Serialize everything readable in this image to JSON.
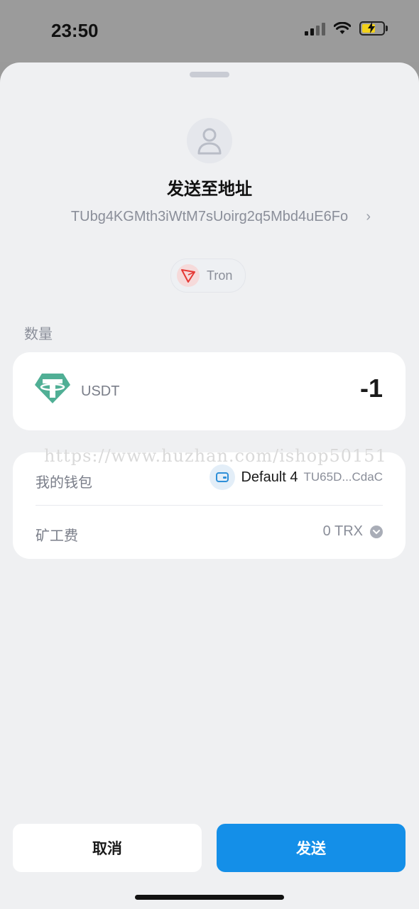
{
  "status_bar": {
    "time": "23:50"
  },
  "recipient": {
    "title": "发送至地址",
    "address": "TUbg4KGMth3iWtM7sUoirg2q5Mbd4uE6Fo",
    "network": "Tron"
  },
  "amount": {
    "section_label": "数量",
    "token": "USDT",
    "value": "-1"
  },
  "details": {
    "wallet_label": "我的钱包",
    "wallet_name": "Default 4",
    "wallet_address": "TU65D...CdaC",
    "fee_label": "矿工费",
    "fee_value": "0 TRX"
  },
  "watermark": "https://www.huzhan.com/ishop50151",
  "actions": {
    "cancel": "取消",
    "send": "发送"
  },
  "colors": {
    "primary": "#148fe8",
    "tether": "#50af95",
    "tron": "#e53935"
  }
}
